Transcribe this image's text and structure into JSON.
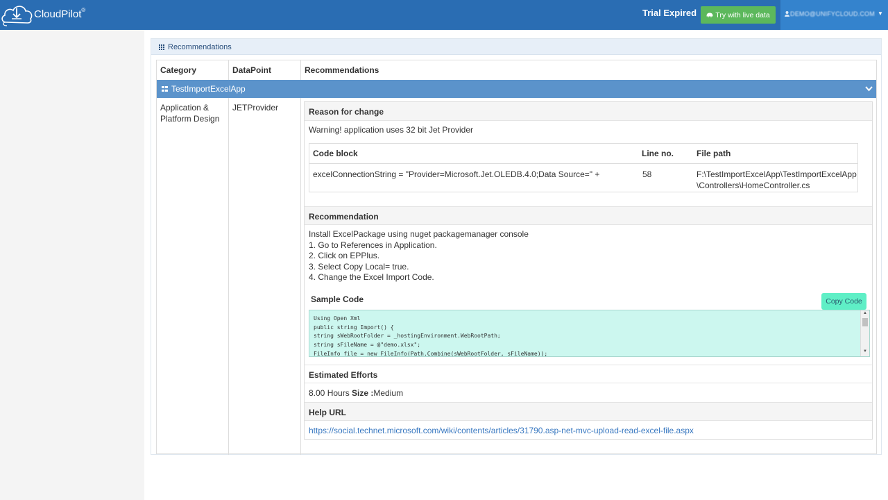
{
  "app": {
    "name": "CloudPilot",
    "registered": "®",
    "trial_status": "Trial Expired",
    "try_button": "Try with live data",
    "user_email": "DEMO@UNIFYCLOUD.COM"
  },
  "panel": {
    "title": "Recommendations",
    "columns": [
      "Category",
      "DataPoint",
      "Recommendations"
    ],
    "group_label": "TestImportExcelApp",
    "row": {
      "category": "Application & Platform Design",
      "datapoint": "JETProvider"
    }
  },
  "detail": {
    "reason_heading": "Reason for change",
    "reason_text": "Warning! application uses 32 bit Jet Provider",
    "code_table": {
      "headers": [
        "Code block",
        "Line no.",
        "File path"
      ],
      "code_block": "excelConnectionString = \"Provider=Microsoft.Jet.OLEDB.4.0;Data Source=\" +",
      "line_no": "58",
      "file_path_1": "F:\\TestImportExcelApp\\TestImportExcelApp",
      "file_path_2": "\\Controllers\\HomeController.cs"
    },
    "recommendation_heading": "Recommendation",
    "recommendation_lines": [
      "Install ExcelPackage using nuget packagemanager console",
      "1. Go to References in Application.",
      "2. Click on EPPlus.",
      "3. Select Copy Local= true.",
      "4. Change the Excel Import Code."
    ],
    "sample_code_heading": "Sample Code",
    "copy_button": "Copy Code",
    "sample_code": "Using Open Xml\npublic string Import() {\nstring sWebRootFolder = _hostingEnvironment.WebRootPath;\nstring sFileName = @\"demo.xlsx\";\nFileInfo file = new FileInfo(Path.Combine(sWebRootFolder, sFileName));",
    "efforts_heading": "Estimated Efforts",
    "efforts_hours": "8.00 Hours",
    "size_label": "Size :",
    "size_value": "Medium",
    "help_heading": "Help URL",
    "help_url": "https://social.technet.microsoft.com/wiki/contents/articles/31790.asp-net-mvc-upload-read-excel-file.aspx"
  },
  "colors": {
    "topbar": "#2a6db3",
    "group_row": "#5b93cb",
    "try_button": "#5cb85c",
    "copy_button": "#5fefc6",
    "code_bg": "#ccf7ef"
  },
  "icons": [
    "cloud-logo-icon",
    "rocket-icon",
    "user-icon",
    "caret-down-icon",
    "grid-icon",
    "chevron-down-icon"
  ]
}
